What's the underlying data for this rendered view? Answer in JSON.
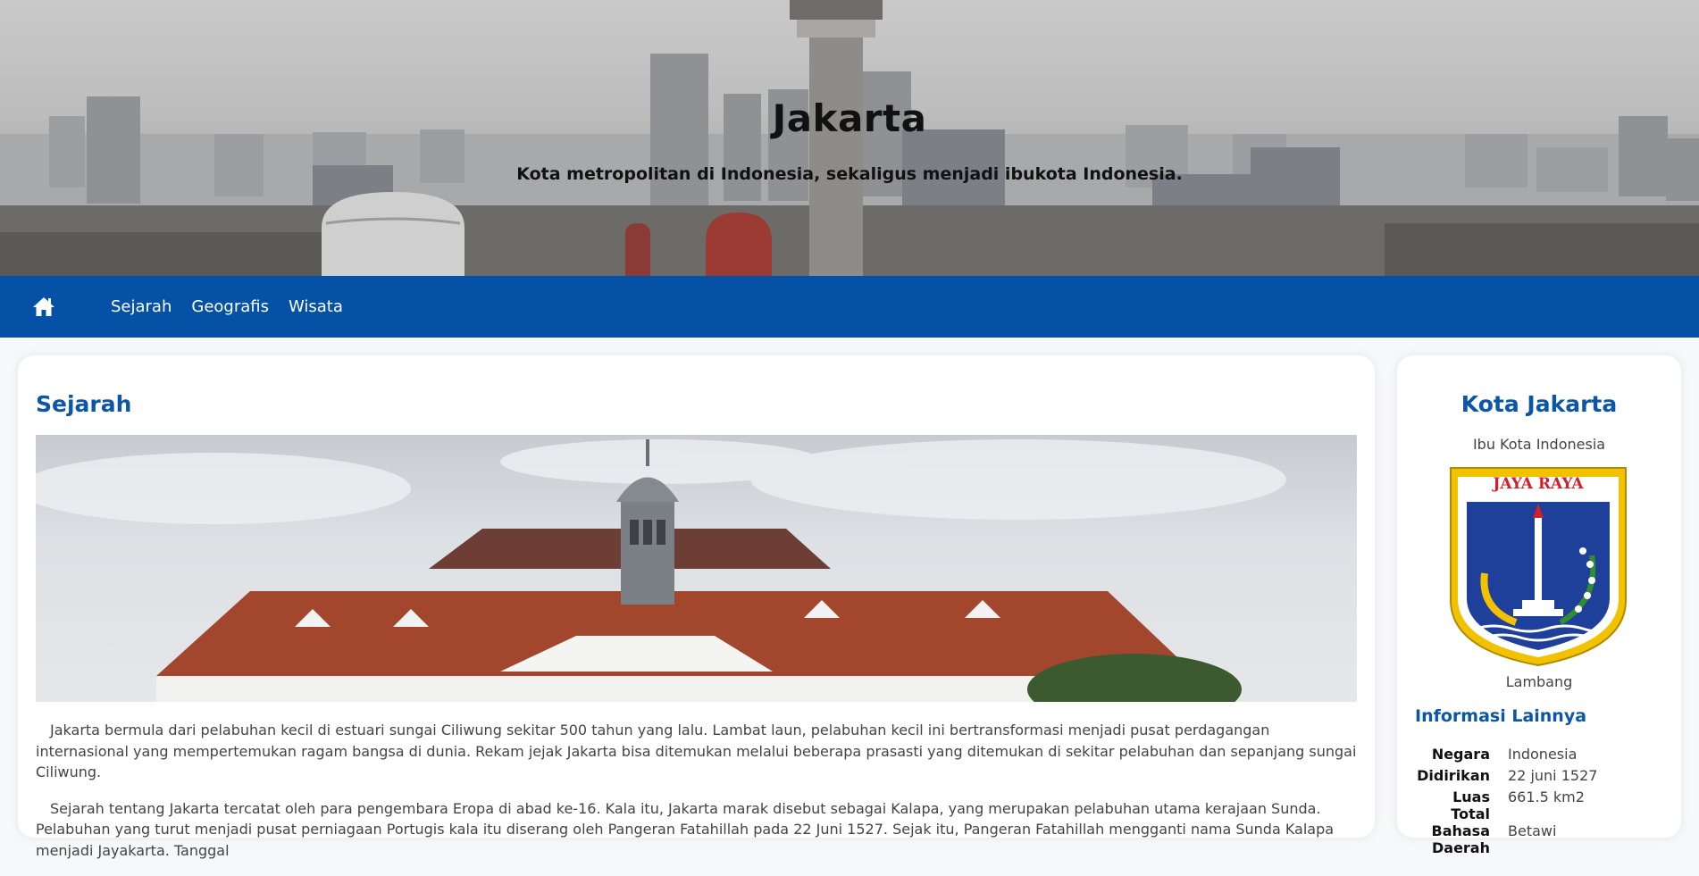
{
  "hero": {
    "title": "Jakarta",
    "subtitle": "Kota metropolitan di Indonesia, sekaligus menjadi ibukota Indonesia."
  },
  "nav": {
    "home_icon": "home-icon",
    "links": [
      "Sejarah",
      "Geografis",
      "Wisata"
    ]
  },
  "main": {
    "heading": "Sejarah",
    "paragraphs": [
      "Jakarta bermula dari pelabuhan kecil di estuari sungai Ciliwung sekitar 500 tahun yang lalu. Lambat laun, pelabuhan kecil ini bertransformasi menjadi pusat perdagangan internasional yang mempertemukan ragam bangsa di dunia. Rekam jejak Jakarta bisa ditemukan melalui beberapa prasasti yang ditemukan di sekitar pelabuhan dan sepanjang sungai Ciliwung.",
      "Sejarah tentang Jakarta tercatat oleh para pengembara Eropa di abad ke-16. Kala itu, Jakarta marak disebut sebagai Kalapa, yang merupakan pelabuhan utama kerajaan Sunda. Pelabuhan yang turut menjadi pusat perniagaan Portugis kala itu diserang oleh Pangeran Fatahillah pada 22 Juni 1527. Sejak itu, Pangeran Fatahillah mengganti nama Sunda Kalapa menjadi Jayakarta. Tanggal"
    ]
  },
  "sidebar": {
    "title": "Kota Jakarta",
    "subtitle": "Ibu Kota Indonesia",
    "emblem_text": "JAYA RAYA",
    "emblem_caption": "Lambang",
    "info_heading": "Informasi Lainnya",
    "info": [
      {
        "key": "Negara",
        "value": "Indonesia"
      },
      {
        "key": "Didirikan",
        "value": "22 juni 1527"
      },
      {
        "key": "Luas Total",
        "value": "661.5 km2"
      },
      {
        "key": "Bahasa Daerah",
        "value": "Betawi"
      }
    ]
  },
  "colors": {
    "nav_bg": "#0551a5",
    "heading_blue": "#0b56a6"
  }
}
